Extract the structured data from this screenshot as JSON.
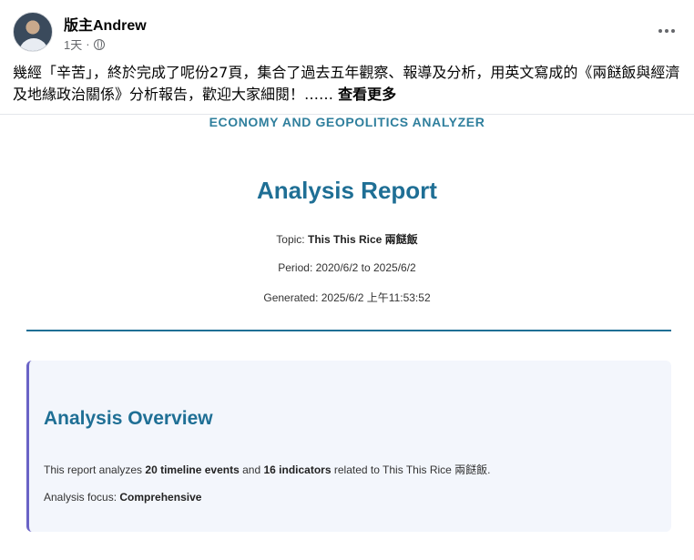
{
  "post": {
    "author": "版主Andrew",
    "time": "1天",
    "separator": "·",
    "audience_icon": "globe-icon",
    "more_icon": "more-options-icon",
    "text": "幾經「辛苦」，終於完成了呢份27頁，集合了過去五年觀察、報導及分析，用英文寫成的《兩餸飯與經濟及地緣政治關係》分析報告，歡迎大家細閱！……",
    "see_more": "查看更多"
  },
  "report": {
    "banner": "ECONOMY AND GEOPOLITICS ANALYZER",
    "title": "Analysis Report",
    "topic_label": "Topic:",
    "topic_value": "This This Rice 兩餸飯",
    "period_label": "Period:",
    "period_value": "2020/6/2 to 2025/6/2",
    "generated_label": "Generated:",
    "generated_value": "2025/6/2 上午11:53:52"
  },
  "overview": {
    "title": "Analysis Overview",
    "text_prefix": "This report analyzes",
    "events": "20 timeline events",
    "text_and": "and",
    "indicators": "16 indicators",
    "text_suffix": "related to This This Rice 兩餸飯.",
    "focus_label": "Analysis focus:",
    "focus_value": "Comprehensive"
  },
  "colors": {
    "accent": "#1f6f95",
    "banner": "#2f7f9d",
    "overview_border": "#6a63c6",
    "overview_bg": "#f3f6fc"
  }
}
